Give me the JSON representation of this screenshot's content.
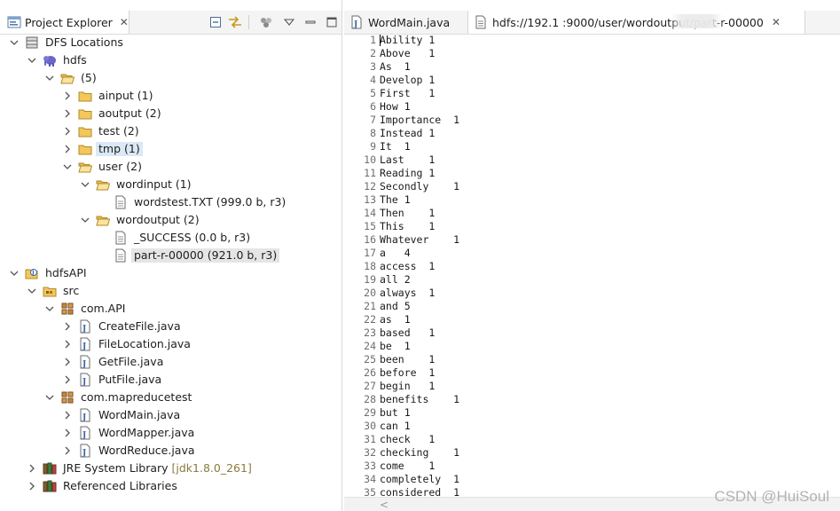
{
  "project_explorer": {
    "tab_title": "Project Explorer",
    "tab_icon": "project-explorer-icon",
    "close_glyph": "✕",
    "toolbar": [
      "collapse-all-icon",
      "link-with-editor-icon",
      "filters-icon",
      "view-menu-icon",
      "minimize-icon",
      "maximize-icon"
    ]
  },
  "tree": [
    {
      "label": "DFS Locations",
      "icon": "dfs-locations-icon",
      "expanded": true
    },
    {
      "label": "hdfs",
      "icon": "elephant-icon",
      "expanded": true
    },
    {
      "label": "(5)",
      "icon": "folder-open-icon",
      "expanded": true
    },
    {
      "label": "ainput (1)",
      "icon": "folder-icon",
      "expanded": false
    },
    {
      "label": "aoutput (2)",
      "icon": "folder-icon",
      "expanded": false
    },
    {
      "label": "test (2)",
      "icon": "folder-icon",
      "expanded": false
    },
    {
      "label": "tmp (1)",
      "icon": "folder-icon",
      "expanded": false,
      "state": "hover"
    },
    {
      "label": "user (2)",
      "icon": "folder-open-icon",
      "expanded": true
    },
    {
      "label": "wordinput (1)",
      "icon": "folder-open-icon",
      "expanded": true
    },
    {
      "label": "wordstest.TXT (999.0 b, r3)",
      "icon": "file-icon"
    },
    {
      "label": "wordoutput (2)",
      "icon": "folder-open-icon",
      "expanded": true
    },
    {
      "label": "_SUCCESS (0.0 b, r3)",
      "icon": "file-icon"
    },
    {
      "label": "part-r-00000 (921.0 b, r3)",
      "icon": "file-icon",
      "state": "selected"
    },
    {
      "label": "hdfsAPI",
      "icon": "java-project-icon",
      "expanded": true
    },
    {
      "label": "src",
      "icon": "source-folder-icon",
      "expanded": true
    },
    {
      "label": "com.API",
      "icon": "package-icon",
      "expanded": true
    },
    {
      "label": "CreateFile.java",
      "icon": "java-file-icon",
      "expanded": false
    },
    {
      "label": "FileLocation.java",
      "icon": "java-file-icon",
      "expanded": false
    },
    {
      "label": "GetFile.java",
      "icon": "java-file-icon",
      "expanded": false
    },
    {
      "label": "PutFile.java",
      "icon": "java-file-icon",
      "expanded": false
    },
    {
      "label": "com.mapreducetest",
      "icon": "package-icon",
      "expanded": true
    },
    {
      "label": "WordMain.java",
      "icon": "java-file-icon",
      "expanded": false
    },
    {
      "label": "WordMapper.java",
      "icon": "java-file-icon",
      "expanded": false
    },
    {
      "label": "WordReduce.java",
      "icon": "java-file-icon",
      "expanded": false
    },
    {
      "label": "JRE System Library",
      "decoration": "[jdk1.8.0_261]",
      "icon": "library-icon",
      "expanded": false
    },
    {
      "label": "Referenced Libraries",
      "icon": "library-icon",
      "expanded": false
    }
  ],
  "editor_tabs": [
    {
      "label": "WordMain.java",
      "icon": "java-file-icon",
      "active": false
    },
    {
      "label": "hdfs://192.1       :9000/user/wordoutput/part-r-00000",
      "icon": "text-file-icon",
      "active": true,
      "close_glyph": "✕"
    }
  ],
  "editor_lines": [
    "Ability 1",
    "Above   1",
    "As  1",
    "Develop 1",
    "First   1",
    "How 1",
    "Importance  1",
    "Instead 1",
    "It  1",
    "Last    1",
    "Reading 1",
    "Secondly    1",
    "The 1",
    "Then    1",
    "This    1",
    "Whatever    1",
    "a   4",
    "access  1",
    "all 2",
    "always  1",
    "and 5",
    "as  1",
    "based   1",
    "be  1",
    "been    1",
    "before  1",
    "begin   1",
    "benefits    1",
    "but 1",
    "can 1",
    "check   1",
    "checking    1",
    "come    1",
    "completely  1",
    "considered  1"
  ],
  "scrollbar_arrow": "<",
  "watermark": "CSDN @HuiSoul",
  "colors": {
    "selection": "#e5e5e5",
    "hover": "#dbe8f5",
    "decoration": "#8c7a3e",
    "folder": "#e8b94a"
  }
}
